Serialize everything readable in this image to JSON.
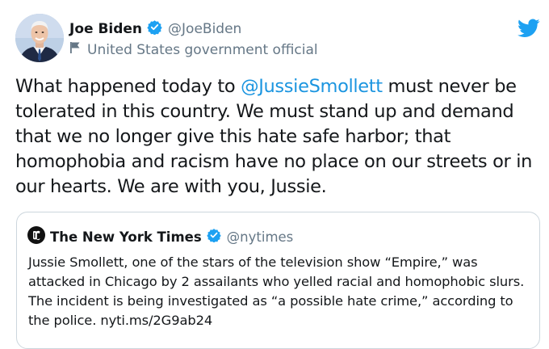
{
  "author": {
    "name": "Joe Biden",
    "handle": "@JoeBiden",
    "label": "United States government official"
  },
  "tweet": {
    "text_before": "What happened today to ",
    "mention": "@JussieSmollett",
    "text_after": " must never be tolerated in this country. We must stand up and demand that we no longer give this hate safe harbor; that homophobia and racism have no place on our streets or in our hearts. We are with you, Jussie."
  },
  "quoted_tweet": {
    "name": "The New York Times",
    "handle": "@nytimes",
    "text": "Jussie Smollett, one of the stars of the television show “Empire,” was attacked in Chicago by 2 assailants who yelled racial and homophobic slurs. The incident is being investigated as “a possible hate crime,” according to the police. nyti.ms/2G9ab24"
  },
  "colors": {
    "link": "#1b95e0",
    "verified": "#1da1f2",
    "secondary_text": "#657786",
    "border": "#ccd6dd"
  },
  "icons": [
    "avatar",
    "verified-badge-icon",
    "flag-icon",
    "twitter-bird-icon",
    "nyt-logo-icon"
  ]
}
